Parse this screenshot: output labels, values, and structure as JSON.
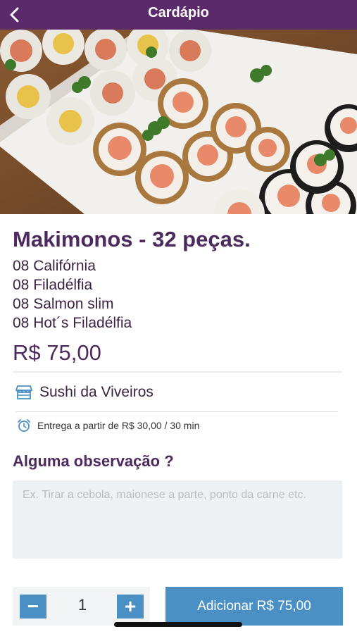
{
  "header": {
    "title": "Cardápio",
    "back_icon": "chevron-left-icon"
  },
  "hero": {
    "image": "sushi-platter-photo"
  },
  "product": {
    "title": "Makimonos - 32 peças.",
    "description": [
      "08 Califórnia",
      "08 Filadélfia",
      "08 Salmon slim",
      "08 Hot´s Filadélfia"
    ],
    "price": "R$ 75,00"
  },
  "store": {
    "icon": "store-icon",
    "name": "Sushi da Viveiros"
  },
  "delivery": {
    "icon": "alarm-clock-icon",
    "text": "Entrega a partir de R$ 30,00 / 30 min"
  },
  "observation": {
    "title": "Alguma observação ?",
    "placeholder": "Ex. Tirar a cebola, maionese a parte, ponto da carne etc.",
    "value": ""
  },
  "quantity": {
    "minus_label": "−",
    "value": "1",
    "plus_label": "+"
  },
  "add_button": {
    "label": "Adicionar R$ 75,00"
  },
  "colors": {
    "header_bg": "#5a2a6a",
    "title_purple": "#4d2a5e",
    "accent_blue": "#4a90c4",
    "input_bg": "#eef1f3"
  }
}
